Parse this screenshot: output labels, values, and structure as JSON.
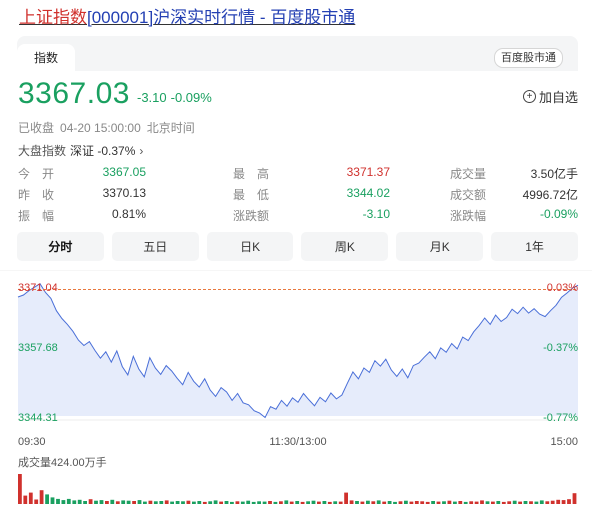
{
  "title": {
    "index_name": "上证指数",
    "code": "[000001]",
    "rest": "沪深实时行情 - 百度股市通"
  },
  "tabs": {
    "active": "指数",
    "brand": "百度股市通"
  },
  "quote": {
    "price": "3367.03",
    "change": "-3.10",
    "change_pct": "-0.09%",
    "watch_label": "加自选"
  },
  "status": {
    "state": "已收盘",
    "datetime": "04-20 15:00:00",
    "zone": "北京时间"
  },
  "market": {
    "label": "大盘指数",
    "value": "深证 -0.37%"
  },
  "stats": [
    [
      {
        "label": "今　开",
        "value": "3367.05",
        "color": "green"
      },
      {
        "label": "最　高",
        "value": "3371.37",
        "color": "red"
      },
      {
        "label": "成交量",
        "value": "3.50亿手",
        "color": "dark"
      }
    ],
    [
      {
        "label": "昨　收",
        "value": "3370.13",
        "color": "dark"
      },
      {
        "label": "最　低",
        "value": "3344.02",
        "color": "green"
      },
      {
        "label": "成交额",
        "value": "4996.72亿",
        "color": "dark"
      }
    ],
    [
      {
        "label": "振　幅",
        "value": "0.81%",
        "color": "dark"
      },
      {
        "label": "涨跌额",
        "value": "-3.10",
        "color": "green"
      },
      {
        "label": "涨跌幅",
        "value": "-0.09%",
        "color": "green"
      }
    ]
  ],
  "periods": [
    "分时",
    "五日",
    "日K",
    "周K",
    "月K",
    "1年"
  ],
  "colors": {
    "up": "#d0312d",
    "down": "#1aa060",
    "line": "#4a6fd8",
    "fill": "#e6ecfb",
    "baseline": "#e8793f"
  },
  "chart_data": {
    "type": "area",
    "title": "",
    "y_ticks_left": [
      "3371.04",
      "3357.68",
      "3344.31"
    ],
    "y_ticks_right": [
      "0.03%",
      "-0.37%",
      "-0.77%"
    ],
    "y_left_values": [
      3371.04,
      3357.68,
      3344.31
    ],
    "x_ticks": [
      "09:30",
      "11:30/13:00",
      "15:00"
    ],
    "prev_close": 3370.13,
    "ylim": [
      3344.31,
      3371.04
    ],
    "series": [
      {
        "values": [
          3368.6,
          3369.0,
          3369.9,
          3370.6,
          3371.3,
          3369.5,
          3368.3,
          3365.8,
          3364.2,
          3363.0,
          3361.6,
          3359.8,
          3358.7,
          3359.5,
          3357.7,
          3356.1,
          3357.4,
          3355.3,
          3357.6,
          3354.4,
          3352.7,
          3356.5,
          3353.9,
          3352.3,
          3356.2,
          3354.1,
          3352.8,
          3354.6,
          3353.5,
          3352.0,
          3350.7,
          3353.2,
          3351.4,
          3350.2,
          3351.9,
          3349.6,
          3348.3,
          3350.1,
          3349.2,
          3347.5,
          3348.9,
          3347.0,
          3346.6,
          3345.4,
          3344.9,
          3344.0,
          3346.2,
          3345.7,
          3347.5,
          3346.3,
          3348.0,
          3347.1,
          3348.9,
          3347.6,
          3346.4,
          3348.1,
          3347.2,
          3349.0,
          3347.8,
          3348.6,
          3351.0,
          3353.3,
          3351.9,
          3354.1,
          3353.2,
          3355.6,
          3354.5,
          3355.9,
          3353.7,
          3352.4,
          3353.9,
          3352.1,
          3354.6,
          3355.1,
          3356.3,
          3357.4,
          3356.0,
          3358.2,
          3357.3,
          3359.1,
          3358.0,
          3360.4,
          3359.7,
          3361.5,
          3362.8,
          3364.3,
          3363.0,
          3364.9,
          3363.6,
          3364.4,
          3366.1,
          3365.2,
          3366.5,
          3365.3,
          3366.2,
          3365.1,
          3364.6,
          3365.8,
          3366.9,
          3368.5,
          3369.4,
          3370.4,
          3371.0
        ]
      },
      {
        "name": "成交量424.00万手",
        "values": [
          1.0,
          0.28,
          0.38,
          0.15,
          0.46,
          0.32,
          0.22,
          0.17,
          0.13,
          0.17,
          0.12,
          0.14,
          0.1,
          0.16,
          0.11,
          0.13,
          0.1,
          0.14,
          0.09,
          0.12,
          0.11,
          0.1,
          0.13,
          0.08,
          0.11,
          0.09,
          0.1,
          0.12,
          0.08,
          0.1,
          0.09,
          0.11,
          0.08,
          0.1,
          0.07,
          0.09,
          0.12,
          0.08,
          0.1,
          0.07,
          0.09,
          0.08,
          0.11,
          0.07,
          0.09,
          0.08,
          0.1,
          0.07,
          0.09,
          0.12,
          0.08,
          0.1,
          0.07,
          0.09,
          0.11,
          0.08,
          0.1,
          0.07,
          0.09,
          0.08,
          0.38,
          0.12,
          0.1,
          0.08,
          0.11,
          0.09,
          0.12,
          0.08,
          0.1,
          0.07,
          0.09,
          0.11,
          0.08,
          0.1,
          0.09,
          0.07,
          0.1,
          0.08,
          0.09,
          0.11,
          0.08,
          0.1,
          0.07,
          0.09,
          0.08,
          0.12,
          0.09,
          0.08,
          0.1,
          0.07,
          0.09,
          0.11,
          0.08,
          0.1,
          0.09,
          0.08,
          0.12,
          0.09,
          0.11,
          0.14,
          0.13,
          0.16,
          0.36
        ]
      }
    ]
  }
}
